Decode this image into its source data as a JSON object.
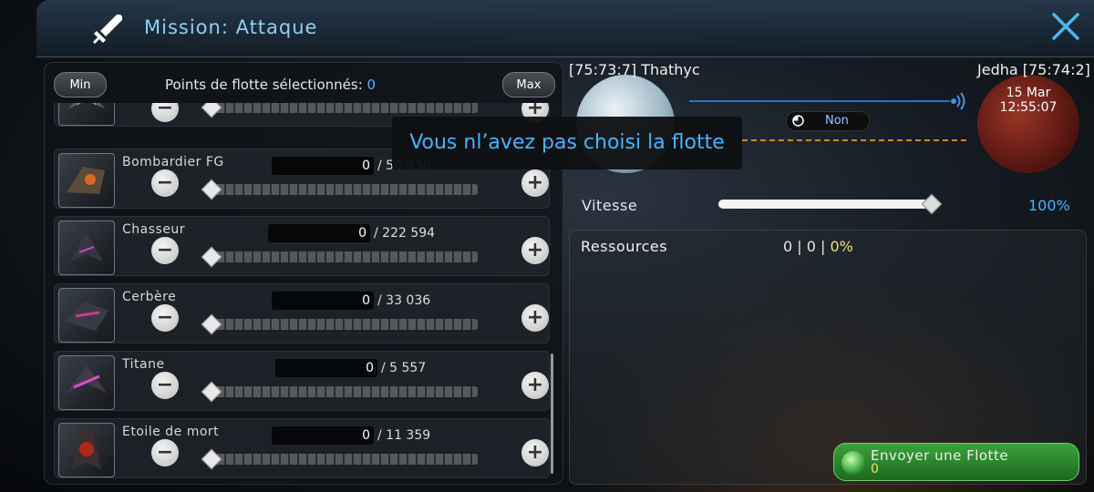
{
  "header": {
    "title": "Mission: Attaque"
  },
  "fleet_panel": {
    "min_label": "Min",
    "max_label": "Max",
    "points_label": "Points de flotte sélectionnés:",
    "points_value": "0",
    "ships": [
      {
        "name": "",
        "count": "",
        "total": ""
      },
      {
        "name": "Bombardier FG",
        "count": "0",
        "total": "/ 50 936"
      },
      {
        "name": "Chasseur",
        "count": "0",
        "total": "/ 222 594"
      },
      {
        "name": "Cerbère",
        "count": "0",
        "total": "/ 33 036"
      },
      {
        "name": "Titane",
        "count": "0",
        "total": "/ 5 557"
      },
      {
        "name": "Etoile de mort",
        "count": "0",
        "total": "/ 11 359"
      }
    ]
  },
  "tooltip": {
    "text": "Vous nl’avez pas choisi la flotte"
  },
  "route": {
    "origin": "[75:73:7] Thathyc",
    "destination": "Jedha [75:74:2]",
    "date": "15 Mar",
    "time": "12:55:07",
    "return_option": "Non"
  },
  "speed": {
    "label": "Vitesse",
    "value": "100%",
    "level": 1.0
  },
  "resources": {
    "label": "Ressources",
    "values": "0 | 0 |",
    "percent": "0%"
  },
  "send_button": {
    "label": "Envoyer une Flotte",
    "count": "0"
  },
  "colors": {
    "accent_blue": "#3fb6ff",
    "send_green": "#2f8f30",
    "route_blue": "#2f6fd0",
    "route_orange": "#d08a24"
  }
}
